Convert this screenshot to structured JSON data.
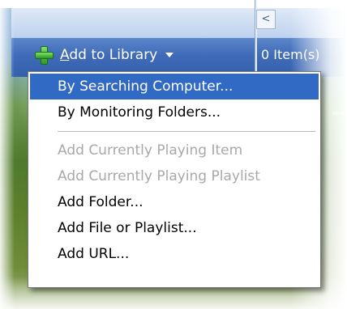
{
  "toolbar": {
    "add_to_library_prefix": "",
    "add_to_library_mnemonic": "A",
    "add_to_library_rest": "dd to Library",
    "item_count": "0 Item(s)",
    "scroll_left_glyph": "<"
  },
  "menu": {
    "items_top": [
      {
        "label": "By Searching Computer...",
        "state": "selected"
      },
      {
        "label": "By Monitoring Folders...",
        "state": "normal"
      }
    ],
    "items_bottom": [
      {
        "label": "Add Currently Playing Item",
        "state": "disabled"
      },
      {
        "label": "Add Currently Playing Playlist",
        "state": "disabled"
      },
      {
        "label": "Add Folder...",
        "state": "normal"
      },
      {
        "label": "Add File or Playlist...",
        "state": "normal"
      },
      {
        "label": "Add URL...",
        "state": "normal"
      }
    ]
  },
  "colors": {
    "selection": "#316ac5",
    "toolbar": "#3f6bb8",
    "disabled_text": "#a8a8a8"
  }
}
